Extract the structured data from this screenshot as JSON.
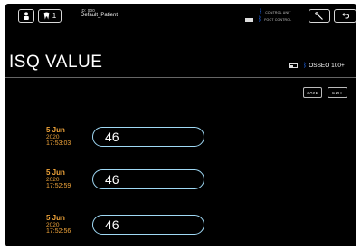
{
  "header": {
    "tooth_number": "1",
    "patient_id": "ID: 000",
    "patient_name": "Default_Patient",
    "status_control_unit": "CONTROL UNIT",
    "status_foot_control": "FOOT CONTROL",
    "icons": {
      "patient": "person-icon",
      "tooth": "tooth-icon",
      "tool": "wrench-icon",
      "back": "return-arrow-icon",
      "bluetooth": "bluetooth-icon",
      "battery": "battery-icon"
    }
  },
  "page": {
    "title": "ISQ VALUE"
  },
  "device": {
    "name": "OSSEO 100+"
  },
  "actions": {
    "save_label": "SAVE",
    "edit_label": "EDIT"
  },
  "measurements": [
    {
      "day": "5 Jun",
      "year": "2020",
      "time": "17:53:03",
      "value": "46"
    },
    {
      "day": "5 Jun",
      "year": "2020",
      "time": "17:52:59",
      "value": "46"
    },
    {
      "day": "5 Jun",
      "year": "2020",
      "time": "17:52:56",
      "value": "46"
    }
  ],
  "colors": {
    "background": "#000000",
    "date_accent": "#f0a43a",
    "pill_border": "#9fd8f4",
    "bluetooth": "#1e6cff"
  }
}
